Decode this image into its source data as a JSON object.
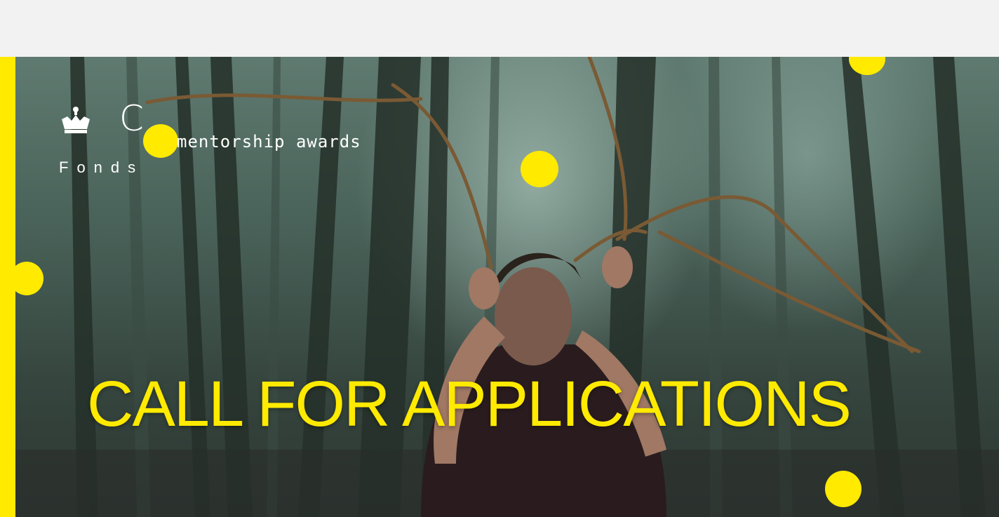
{
  "banner": {
    "logo": {
      "crown_icon": "crown-icon",
      "letter": "C",
      "tagline": "mentorship awards",
      "fonds": "Fonds"
    },
    "headline": "CALL FOR APPLICATIONS",
    "image": "forest-performer-photo"
  },
  "colors": {
    "accent": "#ffea00",
    "top_band": "#f2f2f2",
    "text_light": "#ffffff"
  }
}
